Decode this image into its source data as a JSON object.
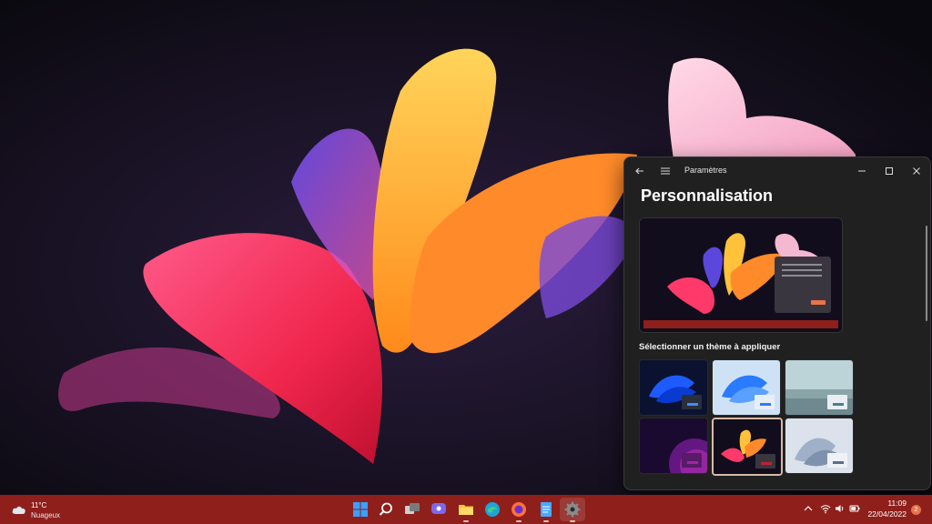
{
  "settings": {
    "app_title": "Paramètres",
    "page_title": "Personnalisation",
    "section_label": "Sélectionner un thème à appliquer",
    "accent": "#d8b9a7"
  },
  "taskbar": {
    "color": "#8e1f1b",
    "weather": {
      "temp": "11°C",
      "condition": "Nuageux"
    },
    "clock": {
      "time": "11:09",
      "date": "22/04/2022"
    },
    "notifications": "2",
    "apps": [
      "start-icon",
      "search-icon",
      "task-view-icon",
      "chat-icon",
      "file-explorer-icon",
      "edge-icon",
      "firefox-icon",
      "notepad-icon",
      "settings-icon"
    ],
    "tray": [
      "chevron-up-icon",
      "wifi-icon",
      "speaker-icon",
      "battery-icon"
    ]
  }
}
